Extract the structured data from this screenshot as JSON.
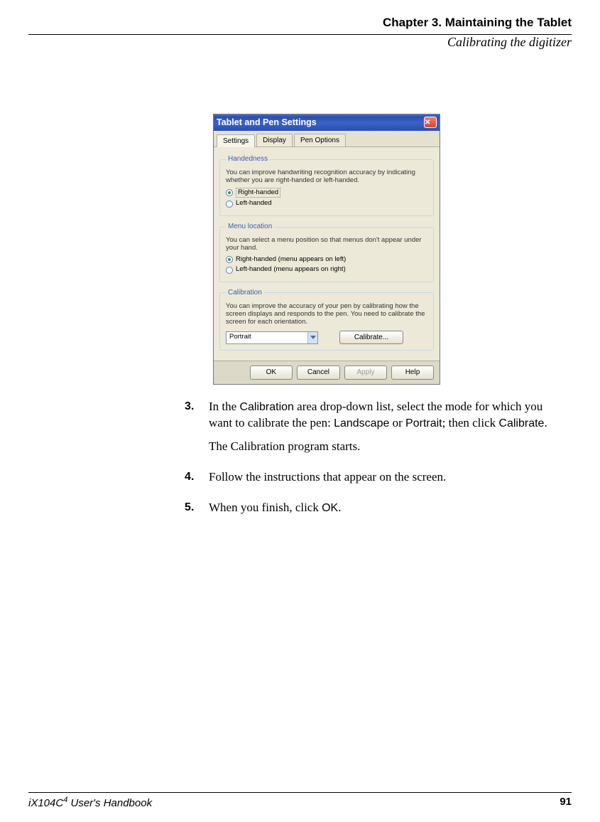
{
  "header": {
    "chapter": "Chapter 3. Maintaining the Tablet",
    "section": "Calibrating the digitizer"
  },
  "dialog": {
    "title": "Tablet and Pen Settings",
    "close_symbol": "✕",
    "tabs": {
      "settings": "Settings",
      "display": "Display",
      "pen_options": "Pen Options"
    },
    "handedness": {
      "legend": "Handedness",
      "desc": "You can improve handwriting recognition accuracy by indicating whether you are right-handed or left-handed.",
      "right": "Right-handed",
      "left": "Left-handed"
    },
    "menu_location": {
      "legend": "Menu location",
      "desc": "You can select a menu position so that menus don't appear under your hand.",
      "right": "Right-handed (menu appears on left)",
      "left": "Left-handed (menu appears on right)"
    },
    "calibration": {
      "legend": "Calibration",
      "desc": "You can improve the accuracy of your pen by calibrating how the screen displays and responds to the pen. You need to calibrate the screen for each orientation.",
      "selected": "Portrait",
      "button": "Calibrate..."
    },
    "footer": {
      "ok": "OK",
      "cancel": "Cancel",
      "apply": "Apply",
      "help": "Help"
    }
  },
  "steps": {
    "s3_num": "3.",
    "s3_a": "In the ",
    "s3_b": "Calibration",
    "s3_c": " area drop-down list, select the mode for which you want to calibrate the pen: ",
    "s3_d": "Landscape",
    "s3_e": " or ",
    "s3_f": "Portrait",
    "s3_g": "; then click ",
    "s3_h": "Calibrate",
    "s3_i": ".",
    "s3_p2": "The Calibration program starts.",
    "s4_num": "4.",
    "s4": "Follow the instructions that appear on the screen.",
    "s5_num": "5.",
    "s5_a": "When you finish, click ",
    "s5_b": "OK",
    "s5_c": "."
  },
  "footer": {
    "book_a": "iX104C",
    "book_sup": "4",
    "book_b": " User's Handbook",
    "page": "91"
  }
}
